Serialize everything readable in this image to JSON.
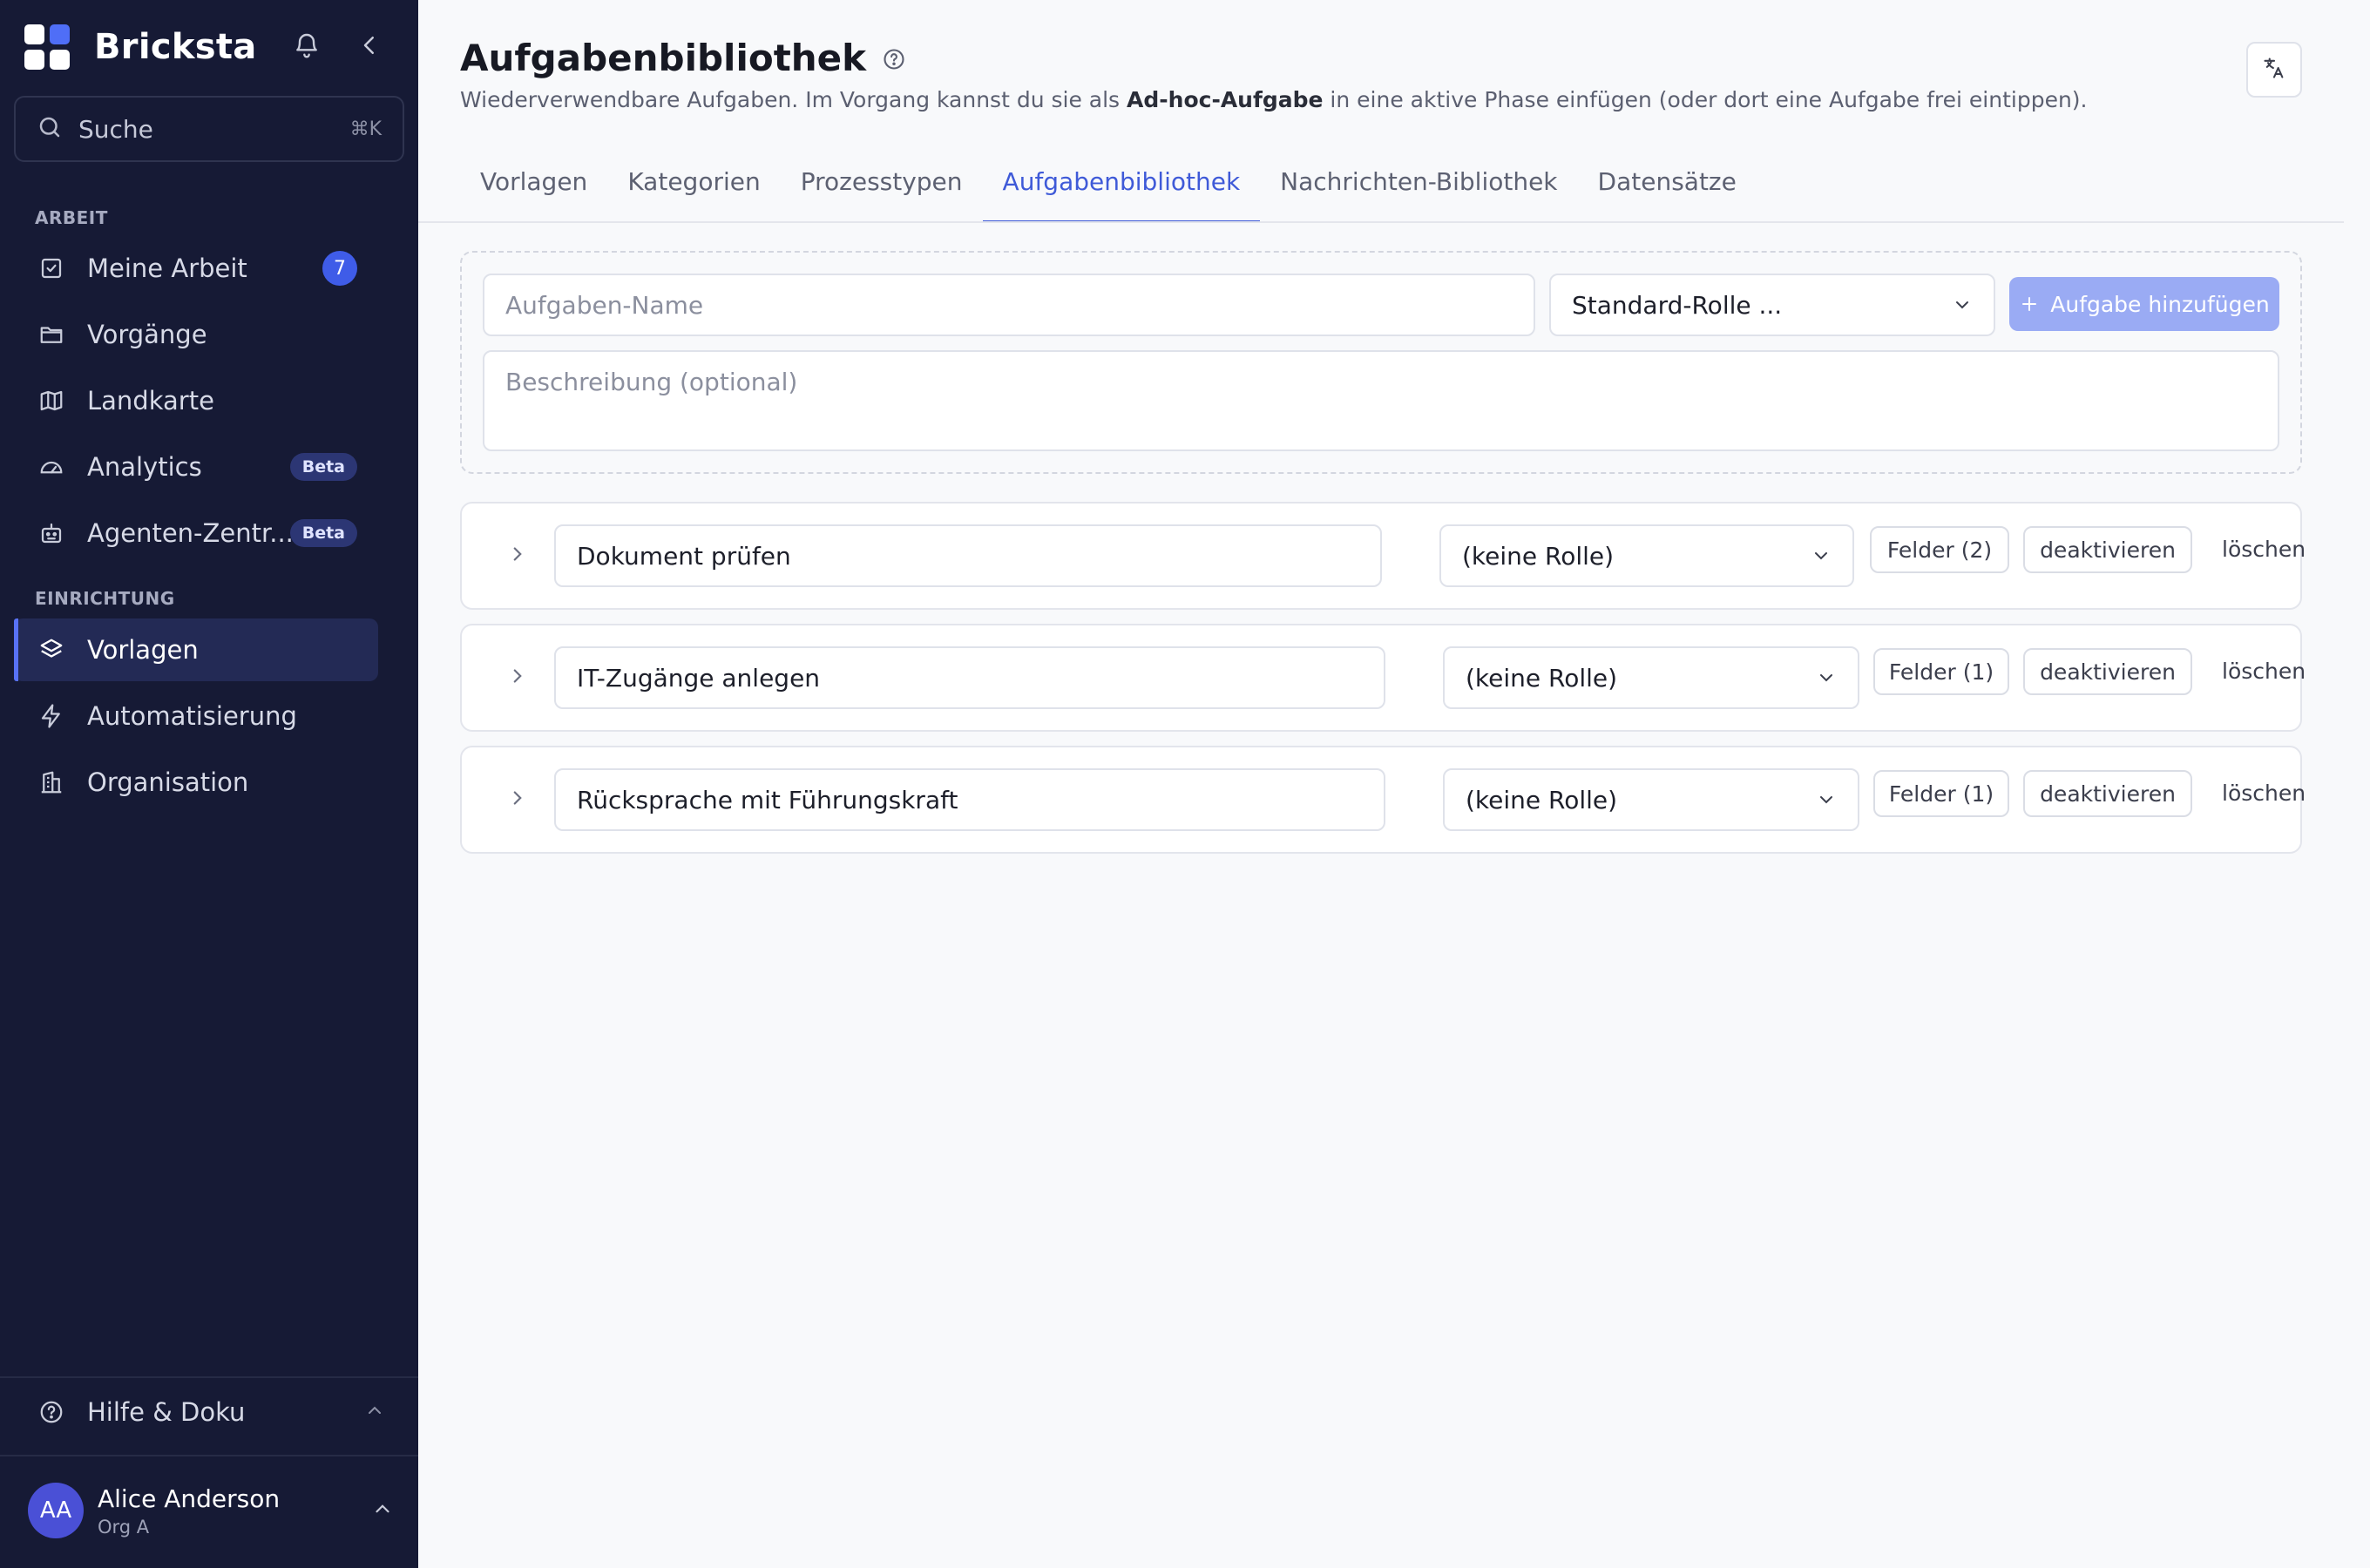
{
  "app": {
    "name": "Bricksta"
  },
  "search": {
    "label": "Suche",
    "shortcut": "⌘K"
  },
  "sidebar": {
    "section_work": "ARBEIT",
    "section_setup": "EINRICHTUNG",
    "items": [
      {
        "label": "Meine Arbeit",
        "badge": "7",
        "icon": "checkbox-icon"
      },
      {
        "label": "Vorgänge",
        "icon": "folder-icon"
      },
      {
        "label": "Landkarte",
        "icon": "map-icon"
      },
      {
        "label": "Analytics",
        "badge": "Beta",
        "icon": "gauge-icon"
      },
      {
        "label": "Agenten-Zentr...",
        "badge": "Beta",
        "icon": "robot-icon"
      },
      {
        "label": "Vorlagen",
        "icon": "layers-icon",
        "active": true
      },
      {
        "label": "Automatisierung",
        "icon": "bolt-icon"
      },
      {
        "label": "Organisation",
        "icon": "building-icon"
      }
    ],
    "help_label": "Hilfe & Doku",
    "user": {
      "initials": "AA",
      "name": "Alice Anderson",
      "org": "Org A"
    }
  },
  "header": {
    "title": "Aufgabenbibliothek",
    "subtitle_pre": "Wiederverwendbare Aufgaben. Im Vorgang kannst du sie als ",
    "subtitle_bold": "Ad-hoc-Aufgabe",
    "subtitle_post": " in eine aktive Phase einfügen (oder dort eine Aufgabe frei eintippen)."
  },
  "tabs": [
    {
      "label": "Vorlagen"
    },
    {
      "label": "Kategorien"
    },
    {
      "label": "Prozesstypen"
    },
    {
      "label": "Aufgabenbibliothek",
      "active": true
    },
    {
      "label": "Nachrichten-Bibliothek"
    },
    {
      "label": "Datensätze"
    }
  ],
  "new_task": {
    "name_placeholder": "Aufgaben-Name",
    "role_select": "Standard-Rolle ...",
    "add_button": "Aufgabe hinzufügen",
    "description_placeholder": "Beschreibung (optional)"
  },
  "tasks": [
    {
      "name": "Dokument prüfen",
      "role": "(keine Rolle)",
      "fields": "Felder (2)",
      "deactivate": "deaktivieren",
      "delete": "löschen"
    },
    {
      "name": "IT-Zugänge anlegen",
      "role": "(keine Rolle)",
      "fields": "Felder (1)",
      "deactivate": "deaktivieren",
      "delete": "löschen"
    },
    {
      "name": "Rücksprache mit Führungskraft",
      "role": "(keine Rolle)",
      "fields": "Felder (1)",
      "deactivate": "deaktivieren",
      "delete": "löschen"
    }
  ],
  "colors": {
    "sidebar_bg": "#161a35",
    "accent": "#3f5ad8",
    "badge": "#3f5ce8",
    "add_button": "#9aabf4"
  }
}
